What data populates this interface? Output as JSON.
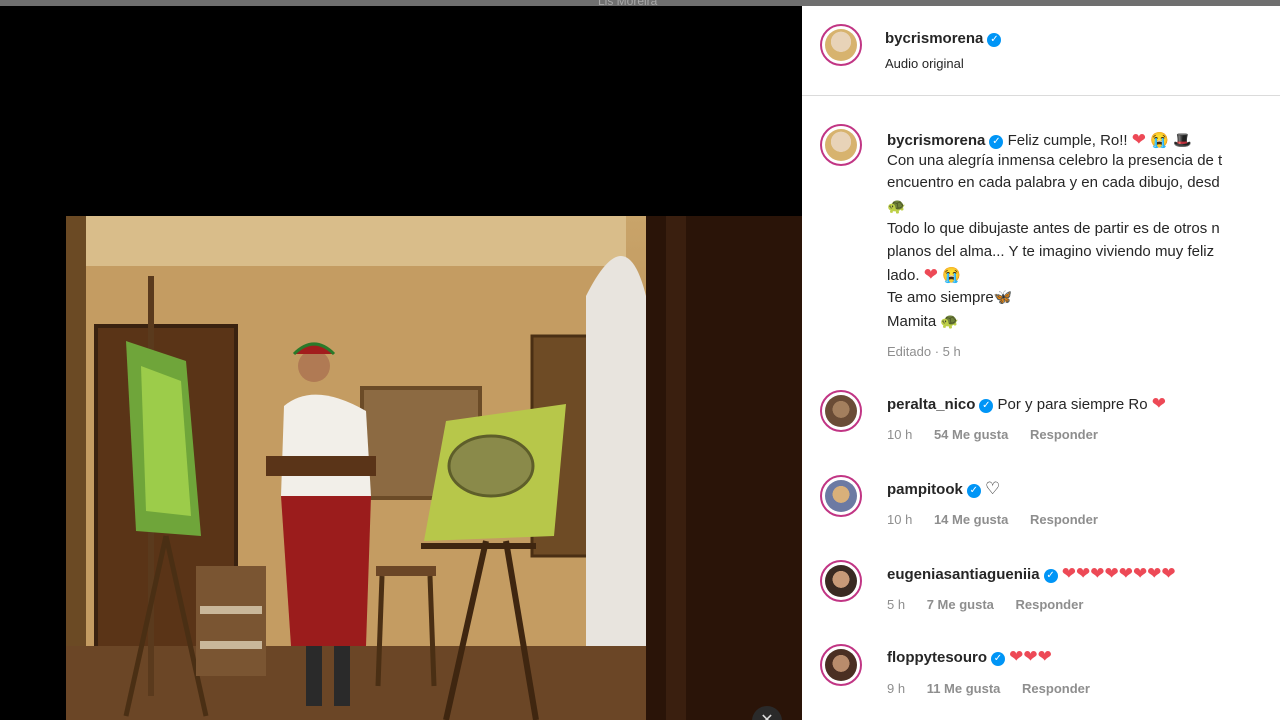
{
  "top_strip": {
    "text": "Lis Moreira"
  },
  "video": {
    "close_label": "✕"
  },
  "header": {
    "username": "bycrismorena",
    "audio": "Audio original"
  },
  "caption": {
    "username": "bycrismorena",
    "lines": [
      "Feliz cumple, Ro!!",
      "Con una alegría inmensa celebro la presencia de t",
      "encuentro en cada palabra y en cada dibujo, desd",
      "",
      "Todo lo que dibujaste antes de partir es de otros n",
      "planos del alma... Y te imagino viviendo muy feliz",
      "lado.",
      "Te amo siempre",
      "Mamita"
    ],
    "edited": "Editado · 5 h"
  },
  "comments": [
    {
      "username": "peralta_nico",
      "text": "Por y para siempre Ro",
      "time": "10 h",
      "likes": "54 Me gusta",
      "reply": "Responder"
    },
    {
      "username": "pampitook",
      "text": "",
      "time": "10 h",
      "likes": "14 Me gusta",
      "reply": "Responder"
    },
    {
      "username": "eugeniasantiagueniia",
      "text": "",
      "time": "5 h",
      "likes": "7 Me gusta",
      "reply": "Responder"
    },
    {
      "username": "floppytesouro",
      "text": "",
      "time": "9 h",
      "likes": "11 Me gusta",
      "reply": "Responder"
    }
  ],
  "colors": {
    "verified": "#0095f6",
    "heart": "#ed4956",
    "avatar_ring": "#c13584"
  }
}
